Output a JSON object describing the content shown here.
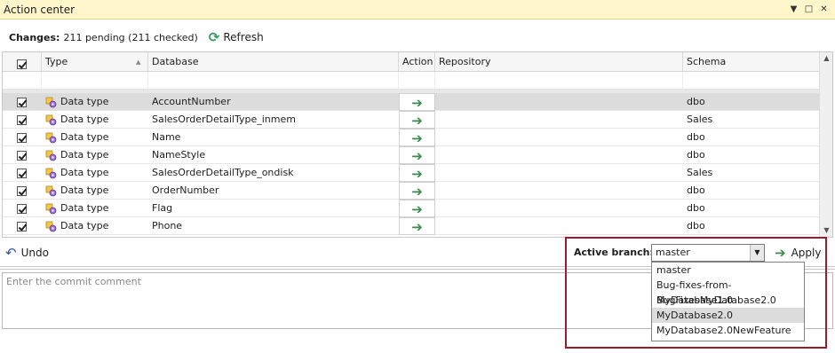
{
  "window": {
    "title": "Action center"
  },
  "toolbar": {
    "changes_label": "Changes:",
    "changes_value": "211 pending (211 checked)",
    "refresh_label": "Refresh"
  },
  "grid": {
    "columns": {
      "type": "Type",
      "database": "Database",
      "action": "Action",
      "repository": "Repository",
      "schema": "Schema"
    },
    "rows": [
      {
        "type": "Data type",
        "database": "AccountNumber",
        "repository": "",
        "schema": "dbo"
      },
      {
        "type": "Data type",
        "database": "SalesOrderDetailType_inmem",
        "repository": "",
        "schema": "Sales"
      },
      {
        "type": "Data type",
        "database": "Name",
        "repository": "",
        "schema": "dbo"
      },
      {
        "type": "Data type",
        "database": "NameStyle",
        "repository": "",
        "schema": "dbo"
      },
      {
        "type": "Data type",
        "database": "SalesOrderDetailType_ondisk",
        "repository": "",
        "schema": "Sales"
      },
      {
        "type": "Data type",
        "database": "OrderNumber",
        "repository": "",
        "schema": "dbo"
      },
      {
        "type": "Data type",
        "database": "Flag",
        "repository": "",
        "schema": "dbo"
      },
      {
        "type": "Data type",
        "database": "Phone",
        "repository": "",
        "schema": "dbo"
      }
    ]
  },
  "undo_label": "Undo",
  "comment": {
    "placeholder": "Enter the commit comment"
  },
  "branch": {
    "label": "Active branch:",
    "value": "master",
    "apply_label": "Apply",
    "options": [
      "master",
      "Bug-fixes-from-MyDatabase1.0",
      "BugFixesMyDatabase2.0",
      "MyDatabase2.0",
      "MyDatabase2.0NewFeature"
    ]
  },
  "colors": {
    "titlebar": "#fff6cc",
    "highlight_border": "#9b1c2e",
    "arrow": "#3c8a4f"
  }
}
